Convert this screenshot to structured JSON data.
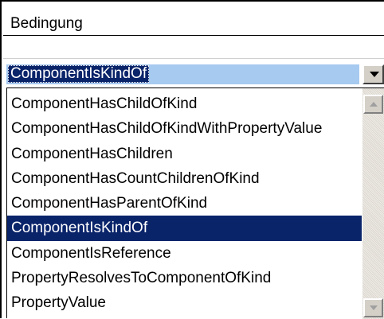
{
  "header": {
    "label": "Bedingung"
  },
  "combo": {
    "value": "ComponentIsKindOf",
    "button_icon": "dropdown-arrow-icon"
  },
  "list": {
    "items": [
      "ComponentHasChildOfKind",
      "ComponentHasChildOfKindWithPropertyValue",
      "ComponentHasChildren",
      "ComponentHasCountChildrenOfKind",
      "ComponentHasParentOfKind",
      "ComponentIsKindOf",
      "ComponentIsReference",
      "PropertyResolvesToComponentOfKind",
      "PropertyValue"
    ],
    "selected": "ComponentIsKindOf"
  },
  "colors": {
    "selection": "#0a246a",
    "combo_highlight": "#a6caf0",
    "button_face": "#d4d0c8"
  }
}
